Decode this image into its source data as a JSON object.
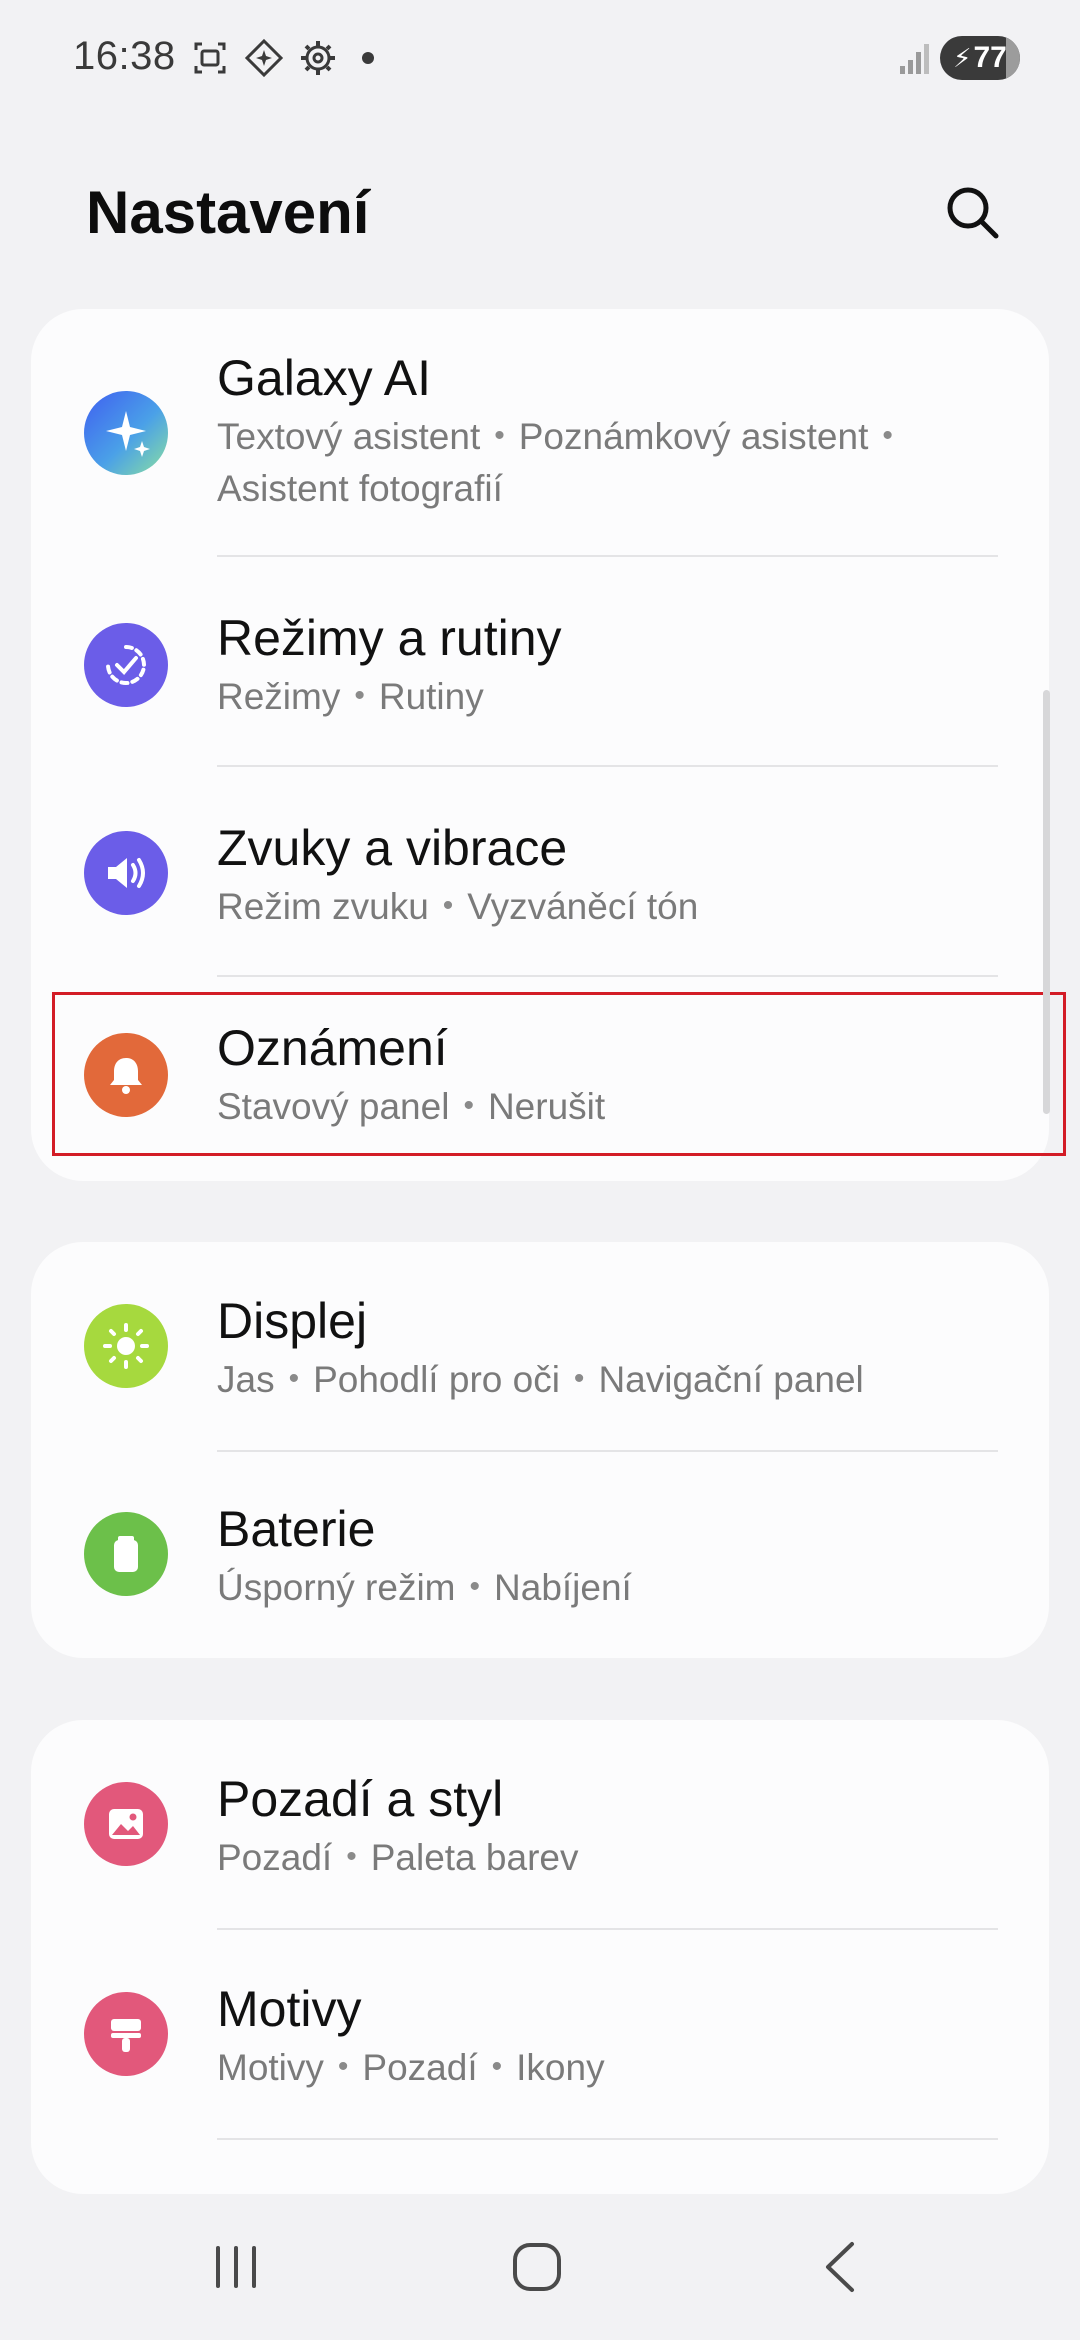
{
  "status_bar": {
    "time": "16:38",
    "icons": [
      "screenshot-icon",
      "assistant-icon",
      "settings-gear-icon",
      "notification-dot"
    ],
    "signal": "signal-icon",
    "battery_level": "77",
    "battery_charging": true
  },
  "header": {
    "title": "Nastavení",
    "search_icon": "search-icon"
  },
  "sections": [
    {
      "items": [
        {
          "title": "Galaxy AI",
          "subtitle_parts": [
            "Textový asistent",
            "Poznámkový asistent",
            "Asistent fotografií"
          ],
          "icon": "galaxy-ai-icon",
          "color": "#4f86ee"
        },
        {
          "title": "Režimy a rutiny",
          "subtitle_parts": [
            "Režimy",
            "Rutiny"
          ],
          "icon": "modes-routines-icon",
          "color": "#6b5de8"
        },
        {
          "title": "Zvuky a vibrace",
          "subtitle_parts": [
            "Režim zvuku",
            "Vyzváněcí tón"
          ],
          "icon": "sound-icon",
          "color": "#6b5de8"
        },
        {
          "title": "Oznámení",
          "subtitle_parts": [
            "Stavový panel",
            "Nerušit"
          ],
          "icon": "bell-icon",
          "color": "#e2693a"
        }
      ]
    },
    {
      "items": [
        {
          "title": "Displej",
          "subtitle_parts": [
            "Jas",
            "Pohodlí pro oči",
            "Navigační panel"
          ],
          "icon": "sun-icon",
          "color": "#a6d93e"
        },
        {
          "title": "Baterie",
          "subtitle_parts": [
            "Úsporný režim",
            "Nabíjení"
          ],
          "icon": "battery-icon",
          "color": "#6cc04a"
        }
      ]
    },
    {
      "items": [
        {
          "title": "Pozadí a styl",
          "subtitle_parts": [
            "Pozadí",
            "Paleta barev"
          ],
          "icon": "image-icon",
          "color": "#e2587b"
        },
        {
          "title": "Motivy",
          "subtitle_parts": [
            "Motivy",
            "Pozadí",
            "Ikony"
          ],
          "icon": "paint-brush-icon",
          "color": "#e2587b"
        }
      ]
    }
  ],
  "highlight_item": "Oznámení",
  "nav_bar": {
    "buttons": [
      "recent-apps-icon",
      "home-icon",
      "back-icon"
    ]
  }
}
